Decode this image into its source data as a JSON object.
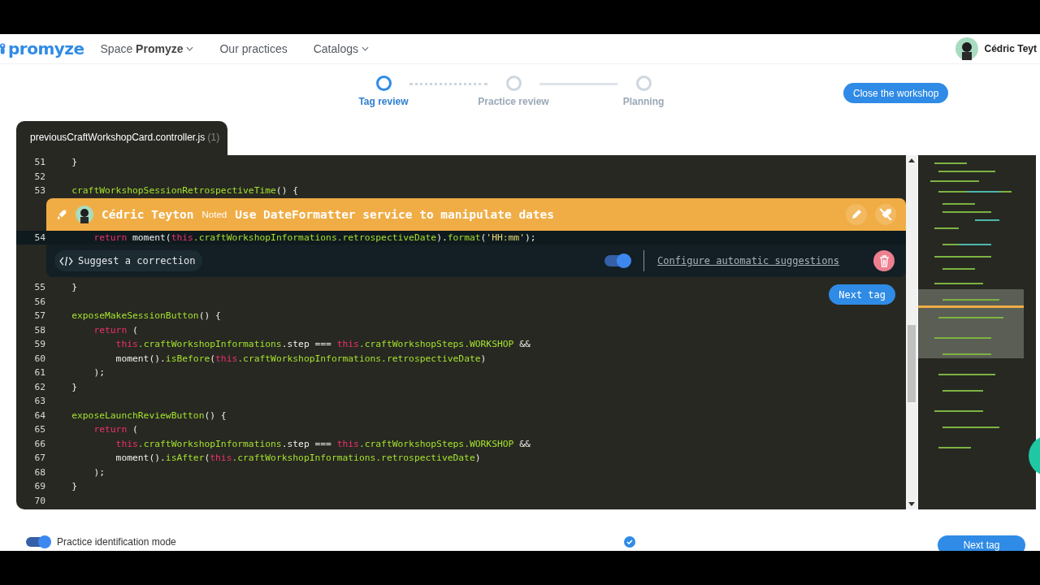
{
  "nav": {
    "logo": "promyze",
    "items": [
      {
        "label": "Space **Promyze**",
        "dropdown": true
      },
      {
        "label": "Our practices",
        "dropdown": false
      },
      {
        "label": "Catalogs",
        "dropdown": true
      }
    ],
    "user": "Cédric Teyt"
  },
  "stepper": {
    "steps": [
      {
        "label": "Tag review",
        "selected": true
      },
      {
        "label": "Practice review",
        "selected": false
      },
      {
        "label": "Planning",
        "selected": false
      }
    ],
    "close_button": "Close the workshop"
  },
  "file_tab": {
    "name": "previousCraftWorkshopCard.controller.js",
    "count": "(1)"
  },
  "code": {
    "lines": [
      {
        "n": "51",
        "annotated": false,
        "tokens": [
          {
            "kind": "plain",
            "text": "    }"
          }
        ]
      },
      {
        "n": "52",
        "annotated": false
      },
      {
        "n": "53",
        "annotated": false,
        "tokens": [
          {
            "kind": "fn",
            "text": "    craftWorkshopSessionRetrospectiveTime"
          },
          {
            "kind": "plain",
            "text": "() {"
          }
        ]
      },
      {
        "n": "54",
        "annotated": true,
        "tokens": [
          {
            "kind": "kw",
            "text": "        return"
          },
          {
            "kind": "plain",
            "text": " moment("
          },
          {
            "kind": "kw",
            "text": "this"
          },
          {
            "kind": "fn",
            "text": ".craftWorkshopInformations.retrospectiveDate"
          },
          {
            "kind": "plain",
            "text": ")."
          },
          {
            "kind": "fn",
            "text": "format"
          },
          {
            "kind": "plain",
            "text": "("
          },
          {
            "kind": "str",
            "text": "'HH:mm'"
          },
          {
            "kind": "plain",
            "text": ");"
          }
        ]
      },
      {
        "n": "55",
        "annotated": false,
        "tokens": [
          {
            "kind": "plain",
            "text": "    }"
          }
        ]
      },
      {
        "n": "56",
        "annotated": false
      },
      {
        "n": "57",
        "annotated": false,
        "tokens": [
          {
            "kind": "fn",
            "text": "    exposeMakeSessionButton"
          },
          {
            "kind": "plain",
            "text": "() {"
          }
        ]
      },
      {
        "n": "58",
        "annotated": false,
        "tokens": [
          {
            "kind": "kw",
            "text": "        return"
          },
          {
            "kind": "plain",
            "text": " ("
          }
        ]
      },
      {
        "n": "59",
        "annotated": false,
        "tokens": [
          {
            "kind": "kw",
            "text": "            this"
          },
          {
            "kind": "fn",
            "text": ".craftWorkshopInformations"
          },
          {
            "kind": "plain",
            "text": ".step === "
          },
          {
            "kind": "kw",
            "text": "this"
          },
          {
            "kind": "fn",
            "text": ".craftWorkshopSteps.WORKSHOP"
          },
          {
            "kind": "plain",
            "text": " &&"
          }
        ]
      },
      {
        "n": "60",
        "annotated": false,
        "tokens": [
          {
            "kind": "plain",
            "text": "            moment()."
          },
          {
            "kind": "fn",
            "text": "isBefore"
          },
          {
            "kind": "plain",
            "text": "("
          },
          {
            "kind": "kw",
            "text": "this"
          },
          {
            "kind": "fn",
            "text": ".craftWorkshopInformations.retrospectiveDate"
          },
          {
            "kind": "plain",
            "text": ")"
          }
        ]
      },
      {
        "n": "61",
        "annotated": false,
        "tokens": [
          {
            "kind": "plain",
            "text": "        );"
          }
        ]
      },
      {
        "n": "62",
        "annotated": false,
        "tokens": [
          {
            "kind": "plain",
            "text": "    }"
          }
        ]
      },
      {
        "n": "63",
        "annotated": false
      },
      {
        "n": "64",
        "annotated": false,
        "tokens": [
          {
            "kind": "fn",
            "text": "    exposeLaunchReviewButton"
          },
          {
            "kind": "plain",
            "text": "() {"
          }
        ]
      },
      {
        "n": "65",
        "annotated": false,
        "tokens": [
          {
            "kind": "kw",
            "text": "        return"
          },
          {
            "kind": "plain",
            "text": " ("
          }
        ]
      },
      {
        "n": "66",
        "annotated": false,
        "tokens": [
          {
            "kind": "kw",
            "text": "            this"
          },
          {
            "kind": "fn",
            "text": ".craftWorkshopInformations"
          },
          {
            "kind": "plain",
            "text": ".step === "
          },
          {
            "kind": "kw",
            "text": "this"
          },
          {
            "kind": "fn",
            "text": ".craftWorkshopSteps.WORKSHOP"
          },
          {
            "kind": "plain",
            "text": " &&"
          }
        ]
      },
      {
        "n": "67",
        "annotated": false,
        "tokens": [
          {
            "kind": "plain",
            "text": "            moment()."
          },
          {
            "kind": "fn",
            "text": "isAfter"
          },
          {
            "kind": "plain",
            "text": "("
          },
          {
            "kind": "kw",
            "text": "this"
          },
          {
            "kind": "fn",
            "text": ".craftWorkshopInformations.retrospectiveDate"
          },
          {
            "kind": "plain",
            "text": ")"
          }
        ]
      },
      {
        "n": "68",
        "annotated": false,
        "tokens": [
          {
            "kind": "plain",
            "text": "        );"
          }
        ]
      },
      {
        "n": "69",
        "annotated": false,
        "tokens": [
          {
            "kind": "plain",
            "text": "    }"
          }
        ]
      },
      {
        "n": "70",
        "annotated": false
      }
    ]
  },
  "annotation": {
    "author": "Cédric Teyton",
    "status": "Noted",
    "title": "Use DateFormatter service to manipulate dates",
    "suggest_button": "Suggest a correction",
    "auto_suggestions": {
      "on": true
    },
    "configure_link": "Configure automatic suggestions"
  },
  "next_tag_button": "Next tag",
  "footer": {
    "practice_mode": {
      "label": "Practice identification mode",
      "on": true
    },
    "next_tag_button": "Next tag"
  }
}
